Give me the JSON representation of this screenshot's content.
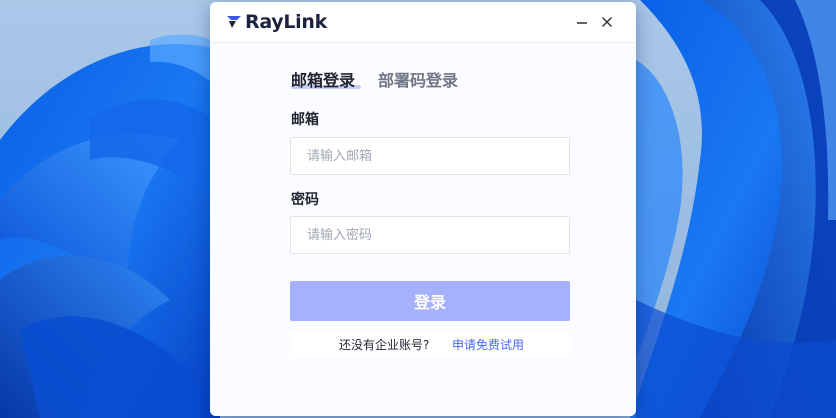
{
  "window": {
    "brand": "RayLink",
    "brand_color": "#1c2340",
    "accent_color": "#4a67f0",
    "controls": [
      "minimize-icon",
      "close-icon"
    ]
  },
  "tabs": [
    {
      "label": "邮箱登录",
      "active": true
    },
    {
      "label": "部署码登录",
      "active": false
    }
  ],
  "form": {
    "email_label": "邮箱",
    "email_placeholder": "请输入邮箱",
    "email_value": "",
    "password_label": "密码",
    "password_placeholder": "请输入密码",
    "password_value": "",
    "login_button": "登录",
    "login_button_color": "#a6b1fd"
  },
  "signup": {
    "prompt": "还没有企业账号?",
    "link": "申请免费试用"
  },
  "desktop": {
    "wallpaper": "windows-11-bloom"
  }
}
